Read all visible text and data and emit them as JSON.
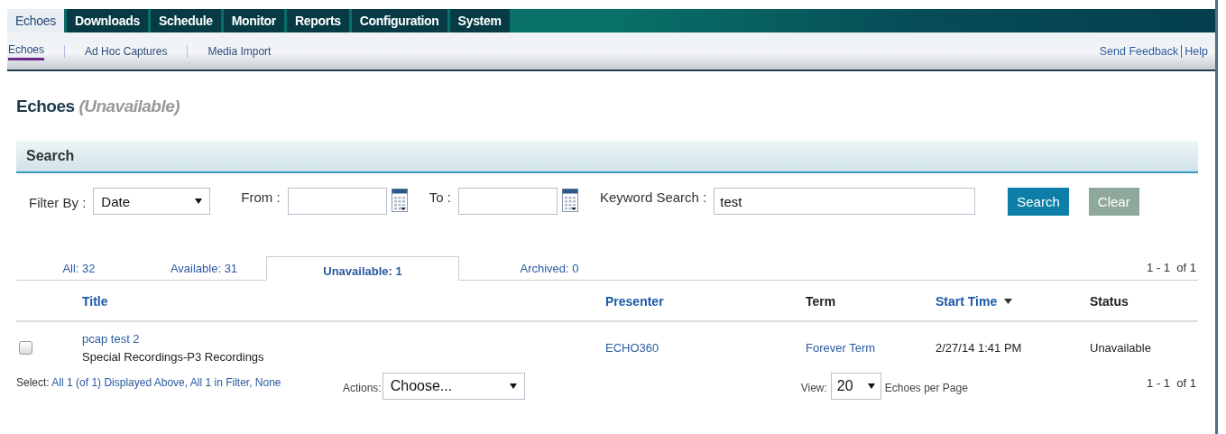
{
  "main_tabs": [
    {
      "label": "Echoes",
      "selected": true
    },
    {
      "label": "Downloads",
      "selected": false
    },
    {
      "label": "Schedule",
      "selected": false
    },
    {
      "label": "Monitor",
      "selected": false
    },
    {
      "label": "Reports",
      "selected": false
    },
    {
      "label": "Configuration",
      "selected": false
    },
    {
      "label": "System",
      "selected": false
    }
  ],
  "sub_tabs": [
    {
      "label": "Echoes",
      "selected": true
    },
    {
      "label": "Ad Hoc Captures",
      "selected": false
    },
    {
      "label": "Media Import",
      "selected": false
    }
  ],
  "utility_links": [
    "Send Feedback",
    "Help"
  ],
  "page_title": {
    "text": "Echoes",
    "qualifier": "(Unavailable)"
  },
  "search": {
    "header": "Search",
    "filter_label": "Filter By :",
    "filter_value": "Date",
    "from_label": "From :",
    "to_label": "To :",
    "keyword_label": "Keyword Search :",
    "keyword_value": "test",
    "search_button": "Search",
    "clear_button": "Clear"
  },
  "status_tabs": [
    {
      "label": "All: 32",
      "selected": false
    },
    {
      "label": "Available: 31",
      "selected": false
    },
    {
      "label": "Unavailable: 1",
      "selected": true
    },
    {
      "label": "Archived: 0",
      "selected": false
    }
  ],
  "pager_top": "1 - 1  of 1",
  "table": {
    "columns": [
      {
        "label": "Title",
        "link": true,
        "sorted": false
      },
      {
        "label": "Presenter",
        "link": true,
        "sorted": false
      },
      {
        "label": "Term",
        "link": false,
        "sorted": false
      },
      {
        "label": "Start Time",
        "link": true,
        "sorted": true
      },
      {
        "label": "Status",
        "link": false,
        "sorted": false
      }
    ],
    "rows": [
      {
        "checked": false,
        "title": "pcap test 2",
        "course": "Special Recordings-P3 Recordings",
        "presenter": "ECHO360",
        "term": "Forever Term",
        "start_time": "2/27/14 1:41 PM",
        "status": "Unavailable"
      }
    ]
  },
  "select": {
    "label": "Select:",
    "links": [
      "All 1 (of 1) Displayed Above,",
      "All 1 in Filter,",
      "None"
    ]
  },
  "actions": {
    "label": "Actions:",
    "value": "Choose..."
  },
  "view": {
    "label": "View:",
    "value": "20",
    "suffix": "Echoes per Page"
  },
  "pager_bottom": "1 - 1  of 1"
}
